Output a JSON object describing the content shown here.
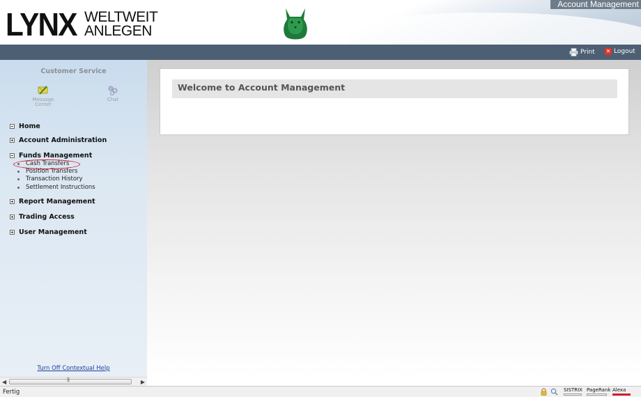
{
  "header": {
    "logo_main": "LYNX",
    "logo_tag_line1": "WELTWEIT",
    "logo_tag_line2": "ANLEGEN",
    "app_title": "Account Management"
  },
  "toolbar": {
    "print_label": "Print",
    "logout_label": "Logout"
  },
  "sidebar": {
    "customer_service_title": "Customer Service",
    "quick_icons": [
      {
        "label_line1": "Message",
        "label_line2": "Center",
        "icon": "message-center-icon"
      },
      {
        "label_line1": "Chat",
        "label_line2": "",
        "icon": "chat-icon"
      }
    ],
    "nav": [
      {
        "label": "Home",
        "expanded": true
      },
      {
        "label": "Account Administration",
        "expanded": false
      },
      {
        "label": "Funds Management",
        "expanded": true,
        "children": [
          "Cash Transfers",
          "Position Transfers",
          "Transaction History",
          "Settlement Instructions"
        ]
      },
      {
        "label": "Report Management",
        "expanded": false
      },
      {
        "label": "Trading Access",
        "expanded": false
      },
      {
        "label": "User Management",
        "expanded": false
      }
    ],
    "highlighted_item": "Cash Transfers",
    "help_link": "Turn Off Contextual Help"
  },
  "main": {
    "welcome_title": "Welcome to Account Management"
  },
  "statusbar": {
    "status_text": "Fertig",
    "badges": [
      "SISTRIX",
      "PageRank",
      "Alexa"
    ]
  },
  "colors": {
    "toolbar_bg": "#4d5f72",
    "highlight_ring": "#d01c2a",
    "link": "#1f3f9a"
  }
}
